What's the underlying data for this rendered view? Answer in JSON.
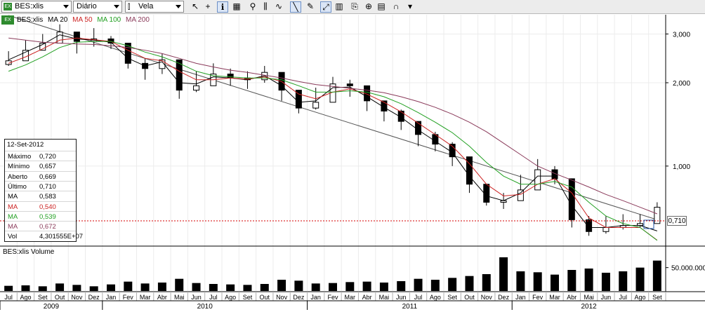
{
  "toolbar": {
    "symbol": "BES:xlis",
    "symbol_icon": "EX",
    "period": "Diário",
    "chart_style": "Vela",
    "icons": [
      "cursor-arrow-icon",
      "crosshair-icon",
      "info-icon",
      "grid-icon",
      "magnifier-icon",
      "bars-icon",
      "wave-icon",
      "trendline-icon",
      "pen-icon",
      "fit-icon",
      "chart-style-icon",
      "copy-icon",
      "zoom-icon",
      "chart-icon",
      "magnet-icon",
      "dropdown-icon"
    ]
  },
  "legend": {
    "symbol": "BES:xlis",
    "items": [
      {
        "label": "MA 20",
        "color": "#000000"
      },
      {
        "label": "MA 50",
        "color": "#cc2222"
      },
      {
        "label": "MA 100",
        "color": "#22a022"
      },
      {
        "label": "MA 200",
        "color": "#8a3a5a"
      }
    ]
  },
  "infobox": {
    "date": "12-Set-2012",
    "rows": [
      {
        "label": "Máximo",
        "value": "0,720",
        "color": "#000000"
      },
      {
        "label": "Mínimo",
        "value": "0,657",
        "color": "#000000"
      },
      {
        "label": "Aberto",
        "value": "0,669",
        "color": "#000000"
      },
      {
        "label": "Último",
        "value": "0,710",
        "color": "#000000"
      },
      {
        "label": "MA",
        "value": "0,583",
        "color": "#000000"
      },
      {
        "label": "MA",
        "value": "0,540",
        "color": "#cc2222"
      },
      {
        "label": "MA",
        "value": "0,539",
        "color": "#22a022"
      },
      {
        "label": "MA",
        "value": "0,672",
        "color": "#8a3a5a"
      },
      {
        "label": "Vol",
        "value": "4,301555E+07",
        "color": "#000000"
      }
    ]
  },
  "price_tag": "0,710",
  "volume_title": "BES:xlis Volume",
  "chart_data": {
    "type": "line",
    "scale": "log",
    "ylim": [
      0.52,
      3.4
    ],
    "y_ticks": [
      {
        "value": 3.0,
        "label": "3,000"
      },
      {
        "value": 2.0,
        "label": "2,000"
      },
      {
        "value": 1.0,
        "label": "1,000"
      }
    ],
    "last_price": 0.71,
    "volume_ylim": [
      0,
      75000000
    ],
    "volume_ticks": [
      {
        "value": 50000000,
        "label": "50.000.000"
      }
    ],
    "months": [
      "Jul",
      "Ago",
      "Set",
      "Out",
      "Nov",
      "Dez",
      "Jan",
      "Fev",
      "Mar",
      "Abr",
      "Mai",
      "Jun",
      "Jul",
      "Ago",
      "Set",
      "Out",
      "Nov",
      "Dez",
      "Jan",
      "Fev",
      "Mar",
      "Abr",
      "Mai",
      "Jun",
      "Jul",
      "Ago",
      "Set",
      "Out",
      "Nov",
      "Dez",
      "Jan",
      "Fev",
      "Mar",
      "Abr",
      "Mai",
      "Jun",
      "Jul",
      "Ago",
      "Set"
    ],
    "years": [
      {
        "label": "2009",
        "start": 0,
        "end": 6
      },
      {
        "label": "2010",
        "start": 6,
        "end": 18
      },
      {
        "label": "2011",
        "start": 18,
        "end": 30
      },
      {
        "label": "2012",
        "start": 30,
        "end": 39
      }
    ],
    "close": [
      2.4,
      2.62,
      2.78,
      3.05,
      2.82,
      2.88,
      2.78,
      2.35,
      2.25,
      2.42,
      1.88,
      1.95,
      2.15,
      2.08,
      2.05,
      2.18,
      1.88,
      1.62,
      1.7,
      1.98,
      1.95,
      1.72,
      1.58,
      1.45,
      1.3,
      1.2,
      1.08,
      0.86,
      0.74,
      0.75,
      0.82,
      0.97,
      0.9,
      0.64,
      0.58,
      0.6,
      0.61,
      0.62,
      0.71
    ],
    "high": [
      2.6,
      2.85,
      3.0,
      3.25,
      3.0,
      3.15,
      2.95,
      2.6,
      2.45,
      2.55,
      2.2,
      2.2,
      2.35,
      2.25,
      2.2,
      2.3,
      2.05,
      1.85,
      1.92,
      2.1,
      2.05,
      1.85,
      1.72,
      1.6,
      1.4,
      1.33,
      1.22,
      1.02,
      0.85,
      0.8,
      0.93,
      1.06,
      1.0,
      0.83,
      0.66,
      0.66,
      0.67,
      0.67,
      0.74
    ],
    "low": [
      2.3,
      2.55,
      2.7,
      2.85,
      2.55,
      2.7,
      2.65,
      2.25,
      2.05,
      2.15,
      1.75,
      1.85,
      1.95,
      1.95,
      1.9,
      2.0,
      1.72,
      1.55,
      1.6,
      1.85,
      1.78,
      1.58,
      1.45,
      1.35,
      1.18,
      1.13,
      1.0,
      0.8,
      0.72,
      0.7,
      0.77,
      0.9,
      0.86,
      0.6,
      0.56,
      0.57,
      0.59,
      0.6,
      0.64
    ],
    "series": [
      {
        "name": "MA 20",
        "color": "#000000",
        "values": [
          2.42,
          2.58,
          2.75,
          2.98,
          2.88,
          2.85,
          2.8,
          2.45,
          2.3,
          2.38,
          2.0,
          1.98,
          2.1,
          2.08,
          2.05,
          2.12,
          1.95,
          1.7,
          1.72,
          1.92,
          1.93,
          1.78,
          1.63,
          1.5,
          1.35,
          1.23,
          1.12,
          0.92,
          0.78,
          0.75,
          0.8,
          0.92,
          0.92,
          0.72,
          0.6,
          0.6,
          0.61,
          0.61,
          0.583
        ]
      },
      {
        "name": "MA 50",
        "color": "#cc2222",
        "values": [
          2.35,
          2.48,
          2.65,
          2.85,
          2.9,
          2.86,
          2.82,
          2.62,
          2.45,
          2.4,
          2.2,
          2.05,
          2.05,
          2.08,
          2.06,
          2.1,
          2.02,
          1.82,
          1.75,
          1.85,
          1.9,
          1.82,
          1.7,
          1.57,
          1.43,
          1.3,
          1.18,
          1.02,
          0.86,
          0.78,
          0.79,
          0.86,
          0.9,
          0.8,
          0.65,
          0.6,
          0.6,
          0.6,
          0.54
        ]
      },
      {
        "name": "MA 100",
        "color": "#22a022",
        "values": [
          2.2,
          2.32,
          2.48,
          2.68,
          2.8,
          2.82,
          2.82,
          2.72,
          2.58,
          2.48,
          2.35,
          2.2,
          2.12,
          2.1,
          2.08,
          2.08,
          2.05,
          1.95,
          1.85,
          1.85,
          1.87,
          1.85,
          1.78,
          1.68,
          1.56,
          1.44,
          1.32,
          1.18,
          1.03,
          0.92,
          0.86,
          0.86,
          0.88,
          0.84,
          0.74,
          0.66,
          0.62,
          0.6,
          0.539
        ]
      },
      {
        "name": "MA 200",
        "color": "#8a3a5a",
        "values": [
          2.9,
          2.85,
          2.8,
          2.78,
          2.76,
          2.75,
          2.72,
          2.68,
          2.62,
          2.55,
          2.45,
          2.35,
          2.28,
          2.22,
          2.18,
          2.13,
          2.08,
          2.02,
          1.97,
          1.94,
          1.91,
          1.88,
          1.84,
          1.78,
          1.71,
          1.63,
          1.54,
          1.44,
          1.33,
          1.21,
          1.1,
          1.0,
          0.94,
          0.89,
          0.84,
          0.79,
          0.75,
          0.71,
          0.672
        ]
      }
    ],
    "trendline": {
      "from": [
        0,
        3.5
      ],
      "to": [
        38,
        0.64
      ]
    },
    "volume": [
      1.1,
      1.2,
      1.0,
      1.6,
      1.3,
      1.0,
      1.4,
      2.0,
      1.6,
      1.8,
      2.6,
      1.7,
      1.5,
      1.4,
      1.3,
      1.5,
      2.4,
      2.2,
      1.6,
      1.7,
      1.9,
      2.0,
      1.8,
      2.1,
      2.6,
      2.4,
      2.8,
      3.2,
      3.6,
      7.2,
      4.2,
      4.0,
      3.5,
      4.5,
      4.8,
      3.9,
      4.2,
      5.0,
      6.5
    ]
  }
}
